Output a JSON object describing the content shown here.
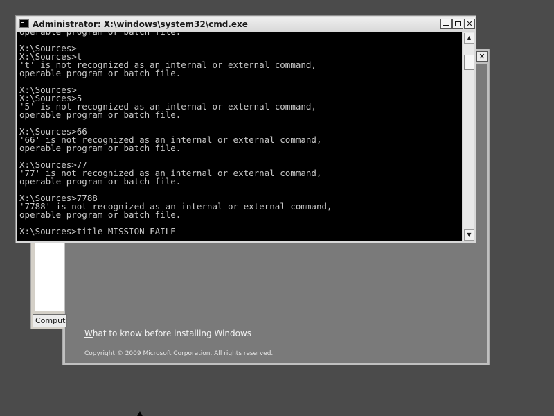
{
  "cmd_window": {
    "title": "Administrator: X:\\windows\\system32\\cmd.exe",
    "buttons": {
      "minimize": "_",
      "maximize": "□",
      "close": "✕"
    },
    "console_lines": [
      "operable program or batch file.",
      "",
      "X:\\Sources>",
      "X:\\Sources>t",
      "'t' is not recognized as an internal or external command,",
      "operable program or batch file.",
      "",
      "X:\\Sources>",
      "X:\\Sources>5",
      "'5' is not recognized as an internal or external command,",
      "operable program or batch file.",
      "",
      "X:\\Sources>66",
      "'66' is not recognized as an internal or external command,",
      "operable program or batch file.",
      "",
      "X:\\Sources>77",
      "'77' is not recognized as an internal or external command,",
      "operable program or batch file.",
      "",
      "X:\\Sources>7788",
      "'7788' is not recognized as an internal or external command,",
      "operable program or batch file.",
      "",
      "X:\\Sources>title MISSION FAILE"
    ],
    "scroll_arrows": {
      "up": "▲",
      "down": "▼"
    }
  },
  "setup_window": {
    "close": "✕",
    "link_accel": "W",
    "link_rest": "hat to know before installing Windows",
    "copyright": "Copyright © 2009 Microsoft Corporation. All rights reserved."
  },
  "sub_dialog": {
    "button_label": "Compute"
  },
  "colors": {
    "desktop": "#4b4b4b",
    "console_bg": "#000000",
    "console_text": "#c8c8c8",
    "setup_panel": "#7a7a7a"
  }
}
